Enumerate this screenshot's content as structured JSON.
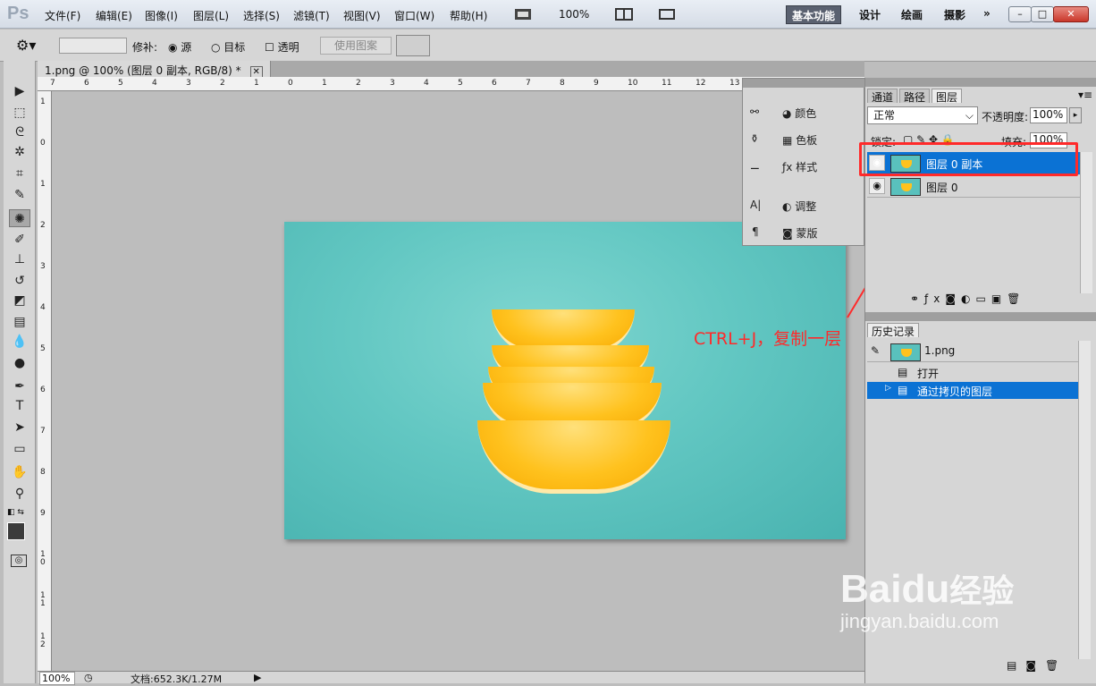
{
  "menubar": {
    "logo": "Ps",
    "menus": [
      "文件(F)",
      "编辑(E)",
      "图像(I)",
      "图层(L)",
      "选择(S)",
      "滤镜(T)",
      "视图(V)",
      "窗口(W)",
      "帮助(H)"
    ],
    "zoom": "100%",
    "workspaces": [
      "基本功能",
      "设计",
      "绘画",
      "摄影"
    ],
    "more": "»",
    "window_controls": [
      "–",
      "□",
      "✕"
    ]
  },
  "options": {
    "repair_label": "修补:",
    "source": "源",
    "target": "目标",
    "transparent": "透明",
    "use_pattern": "使用图案"
  },
  "document": {
    "tab_title": "1.png @ 100% (图层 0 副本, RGB/8) *",
    "status_zoom": "100%",
    "status_doc": "文档:652.3K/1.27M"
  },
  "rulers": {
    "h_labels": [
      "7",
      "6",
      "5",
      "4",
      "3",
      "2",
      "1",
      "0",
      "1",
      "2",
      "3",
      "4",
      "5",
      "6",
      "7",
      "8",
      "9",
      "10",
      "11",
      "12",
      "13"
    ],
    "v_labels": [
      "1",
      "0",
      "1",
      "2",
      "3",
      "4",
      "5",
      "6",
      "7",
      "8",
      "9",
      "1 0",
      "1 1",
      "1 2"
    ]
  },
  "mini_panel": {
    "color": "颜色",
    "swatches": "色板",
    "styles": "样式",
    "adjustments": "调整",
    "masks": "蒙版"
  },
  "layers_panel": {
    "tabs": [
      "通道",
      "路径",
      "图层"
    ],
    "blend_mode": "正常",
    "opacity_label": "不透明度:",
    "opacity": "100%",
    "lock_label": "锁定:",
    "fill_label": "填充:",
    "fill": "100%",
    "layers": [
      "图层 0 副本",
      "图层 0"
    ]
  },
  "history_panel": {
    "title": "历史记录",
    "snapshot": "1.png",
    "states": [
      "打开",
      "通过拷贝的图层"
    ]
  },
  "annotation": "CTRL+J，复制一层",
  "watermark": {
    "brand": "Bai",
    "brand2": "du",
    "cn": "经验",
    "url": "jingyan.baidu.com"
  }
}
